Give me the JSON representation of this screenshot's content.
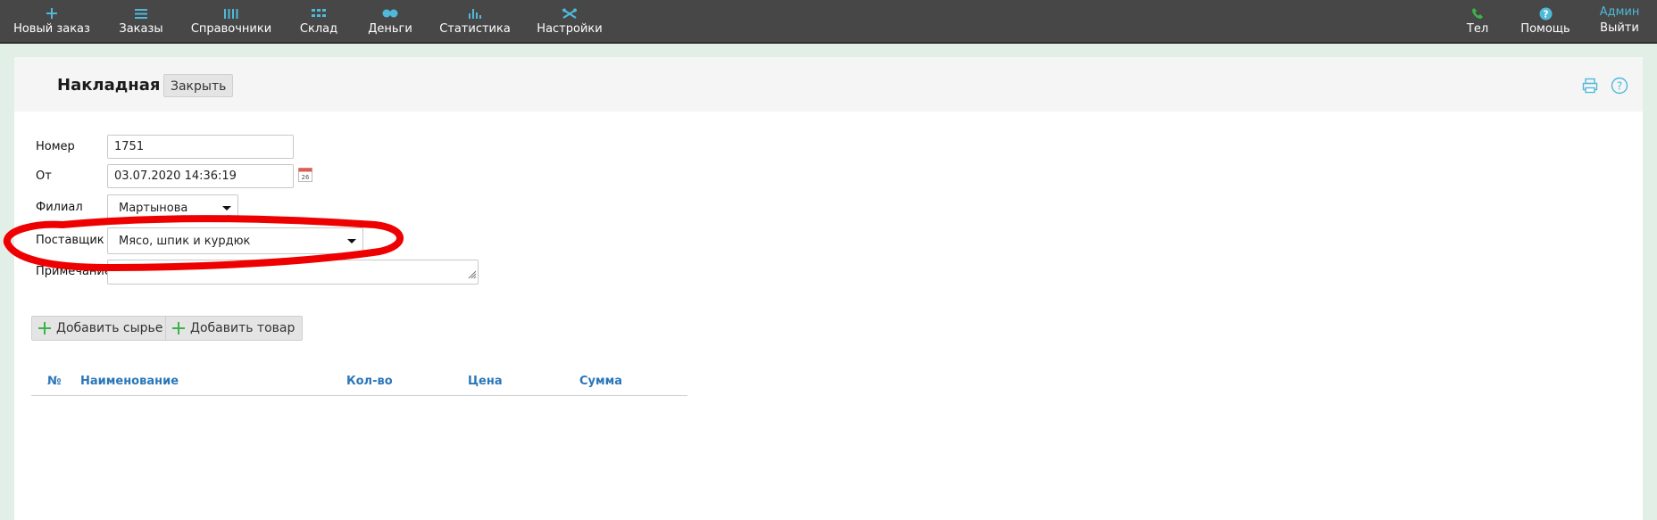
{
  "nav": {
    "left": [
      {
        "label": "Новый заказ",
        "icon": "plus-icon"
      },
      {
        "label": "Заказы",
        "icon": "list-icon"
      },
      {
        "label": "Справочники",
        "icon": "bars-icon"
      },
      {
        "label": "Склад",
        "icon": "grid-icon"
      },
      {
        "label": "Деньги",
        "icon": "coins-icon"
      },
      {
        "label": "Статистика",
        "icon": "chart-icon"
      },
      {
        "label": "Настройки",
        "icon": "tools-icon"
      }
    ],
    "right": [
      {
        "label": "Тел",
        "icon": "phone-icon"
      },
      {
        "label": "Помощь",
        "icon": "help-icon"
      }
    ],
    "user": {
      "name": "Админ",
      "logout_label": "Выйти"
    }
  },
  "document": {
    "title": "Накладная",
    "close_label": "Закрыть"
  },
  "form": {
    "number_label": "Номер",
    "number_value": "1751",
    "date_label": "От",
    "date_value": "03.07.2020 14:36:19",
    "calendar_day": "26",
    "branch_label": "Филиал",
    "branch_value": "Мартынова",
    "supplier_label": "Поставщик",
    "supplier_value": "Мясо, шпик и курдюк",
    "note_label": "Примечание",
    "note_value": ""
  },
  "actions": {
    "add_raw_label": "Добавить сырье",
    "add_product_label": "Добавить товар"
  },
  "table": {
    "columns": [
      "№",
      "Наименование",
      "Кол-во",
      "Цена",
      "Сумма"
    ],
    "rows": []
  },
  "colors": {
    "topbar": "#474747",
    "accent": "#4fb9d8",
    "header_link": "#2a77b8",
    "add_icon": "#3cb34a",
    "annotation": "#ee0000"
  }
}
